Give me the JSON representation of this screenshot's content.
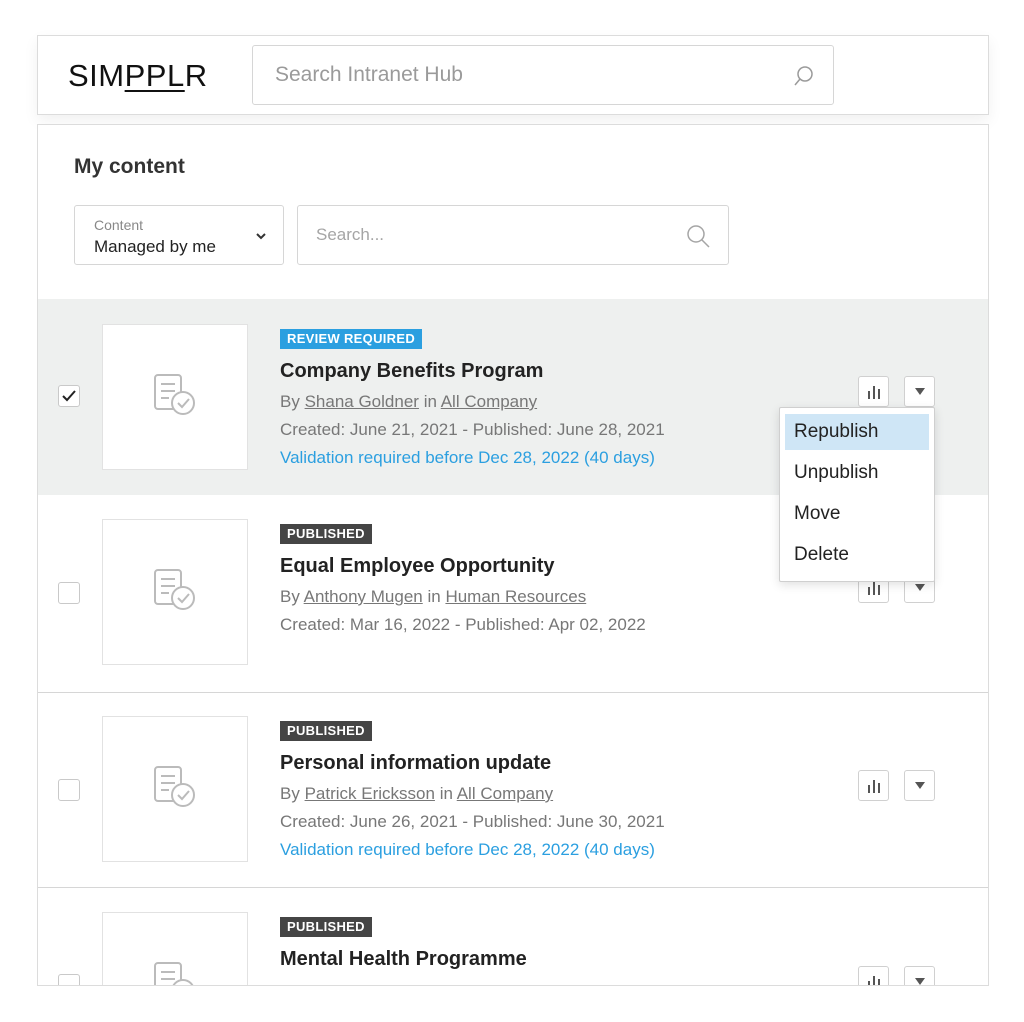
{
  "header": {
    "logo_prefix": "SIM",
    "logo_underlined": "PPL",
    "logo_suffix": "R",
    "search_placeholder": "Search Intranet Hub"
  },
  "page": {
    "title": "My content",
    "filter": {
      "label": "Content",
      "value": "Managed by me"
    },
    "search_placeholder": "Search..."
  },
  "items": [
    {
      "checked": true,
      "status": "REVIEW REQUIRED",
      "title": "Company Benefits Program",
      "by": "By",
      "author": "Shana Goldner",
      "in": "in",
      "site": "All Company",
      "dates": "Created: June 21, 2021 - Published: June 28, 2021",
      "validation": "Validation required before Dec 28, 2022 (40 days)"
    },
    {
      "checked": false,
      "status": "PUBLISHED",
      "title": "Equal Employee Opportunity",
      "by": "By",
      "author": "Anthony Mugen",
      "in": "in",
      "site": "Human Resources",
      "dates": "Created: Mar 16, 2022 - Published: Apr 02, 2022"
    },
    {
      "checked": false,
      "status": "PUBLISHED",
      "title": "Personal information update",
      "by": "By",
      "author": "Patrick Ericksson",
      "in": "in",
      "site": "All Company",
      "dates": "Created: June 26, 2021 - Published: June 30, 2021",
      "validation": "Validation required before Dec 28, 2022 (40 days)"
    },
    {
      "checked": false,
      "status": "PUBLISHED",
      "title": "Mental Health Programme"
    }
  ],
  "action_menu": {
    "options": [
      "Republish",
      "Unpublish",
      "Move",
      "Delete"
    ],
    "highlighted": "Republish"
  },
  "colors": {
    "accent_blue": "#2b9fe0",
    "published_badge": "#454545",
    "selected_row": "#eef0ef",
    "menu_highlight": "#cfe6f6"
  }
}
